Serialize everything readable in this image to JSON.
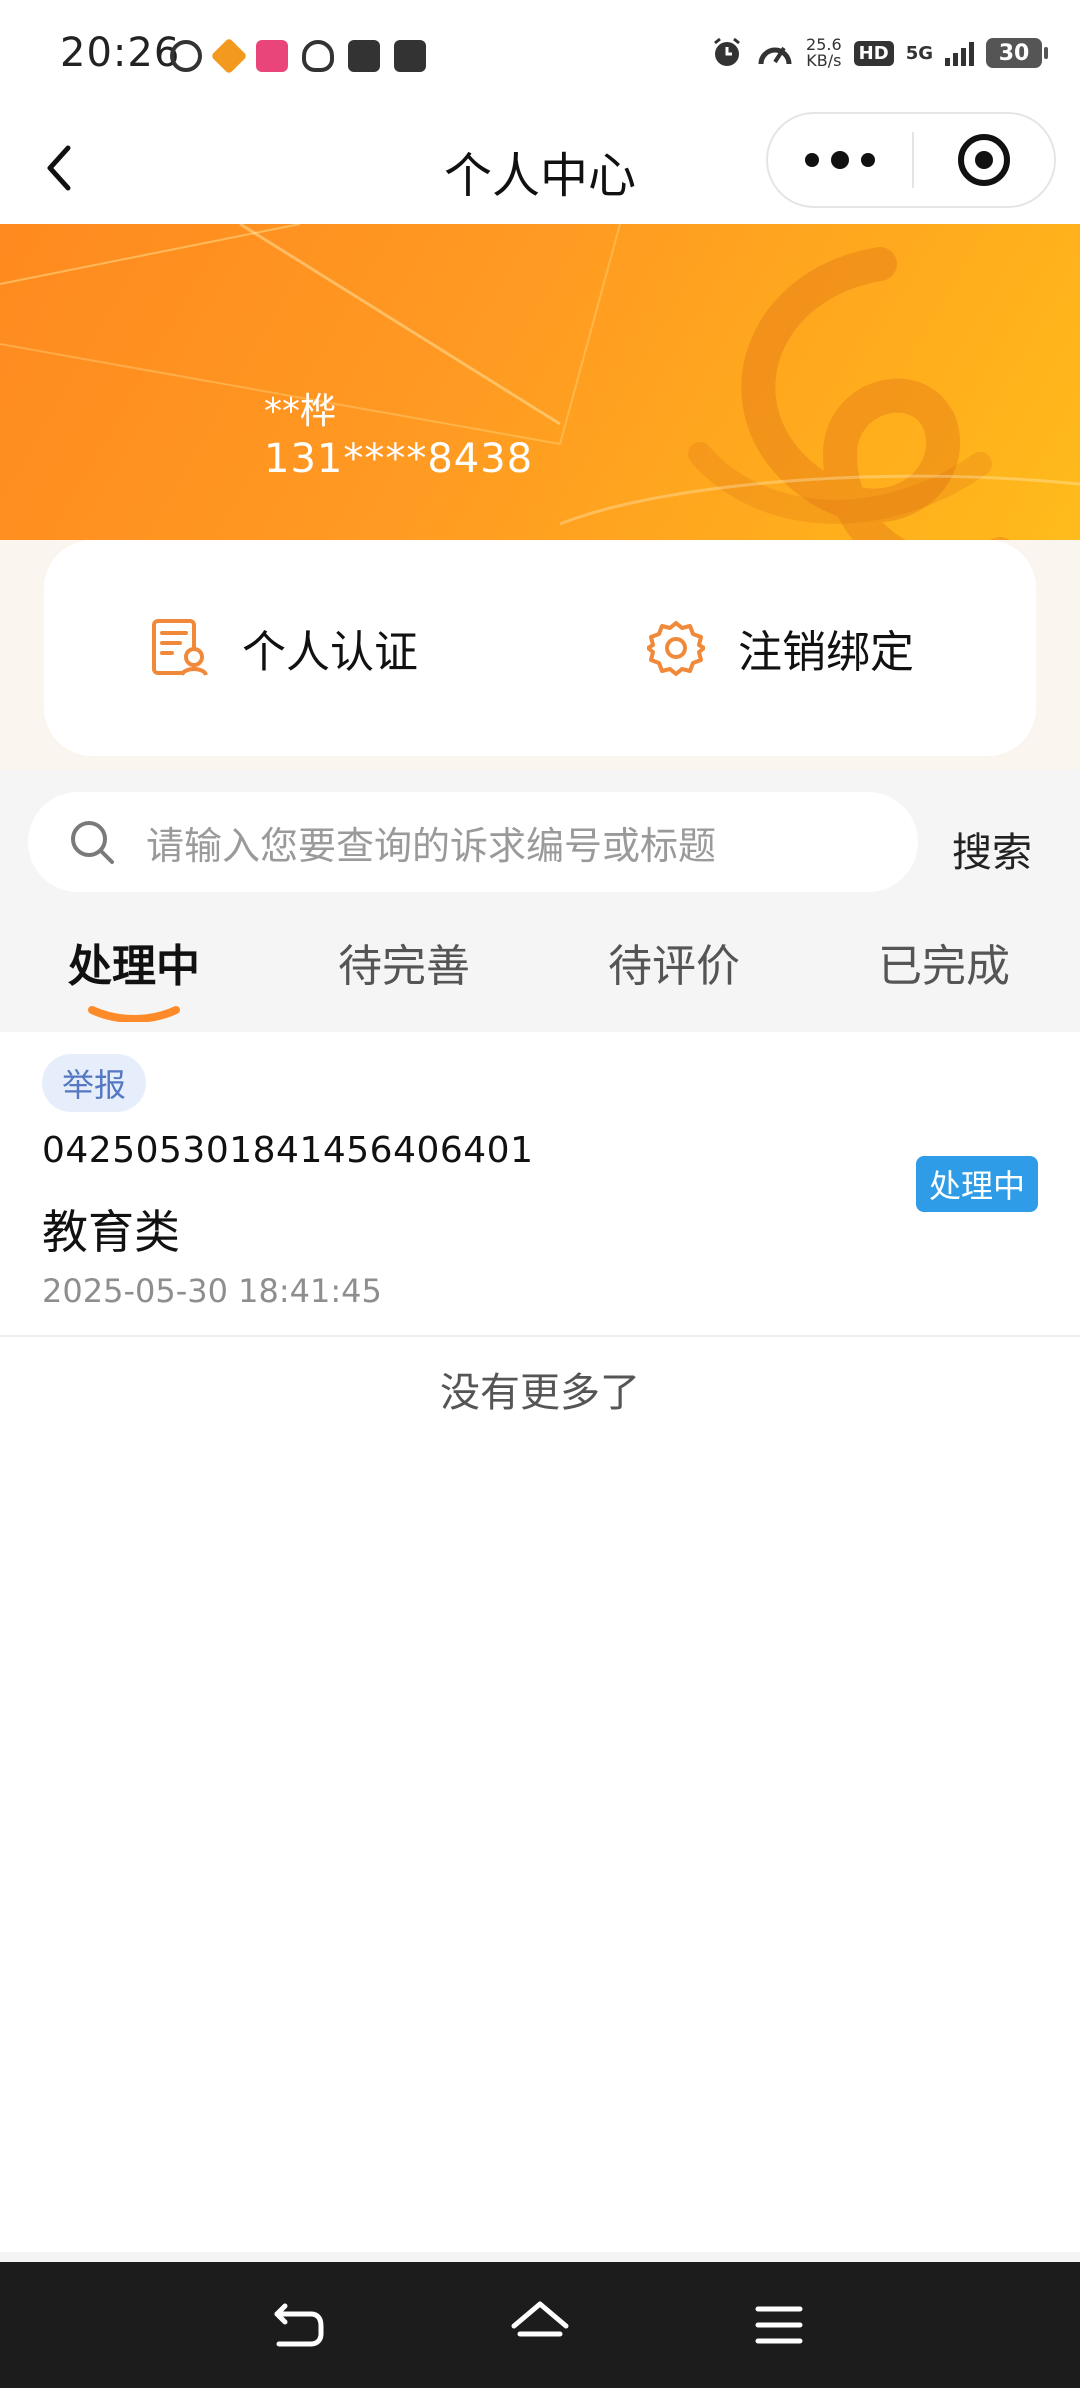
{
  "status_bar": {
    "time": "20:26",
    "app_icons": [
      "netease-music-icon",
      "pinduoduo-icon",
      "bilibili-icon",
      "weibo-icon",
      "taobao-icon",
      "tv-icon"
    ],
    "net_speed_value": "25.6",
    "net_speed_unit": "KB/s",
    "hd_label": "HD",
    "network_label": "5G",
    "battery_level": "30"
  },
  "navbar": {
    "title": "个人中心"
  },
  "profile": {
    "name": "**桦",
    "phone": "131****8438"
  },
  "actions": {
    "certification_label": "个人认证",
    "unbind_label": "注销绑定"
  },
  "search": {
    "placeholder": "请输入您要查询的诉求编号或标题",
    "button_label": "搜索"
  },
  "tabs": [
    {
      "label": "处理中",
      "active": true
    },
    {
      "label": "待完善",
      "active": false
    },
    {
      "label": "待评价",
      "active": false
    },
    {
      "label": "已完成",
      "active": false
    }
  ],
  "items": [
    {
      "tag": "举报",
      "code": "0425053018414564064​01",
      "title": "教育类",
      "time": "2025-05-30 18:41:45",
      "status": "处理中"
    }
  ],
  "list_footer": "没有更多了",
  "colors": {
    "banner_orange": "#ff9a22",
    "accent_orange": "#f08a3a",
    "status_blue": "#2e9ce6",
    "tag_blue": "#5677c2"
  }
}
